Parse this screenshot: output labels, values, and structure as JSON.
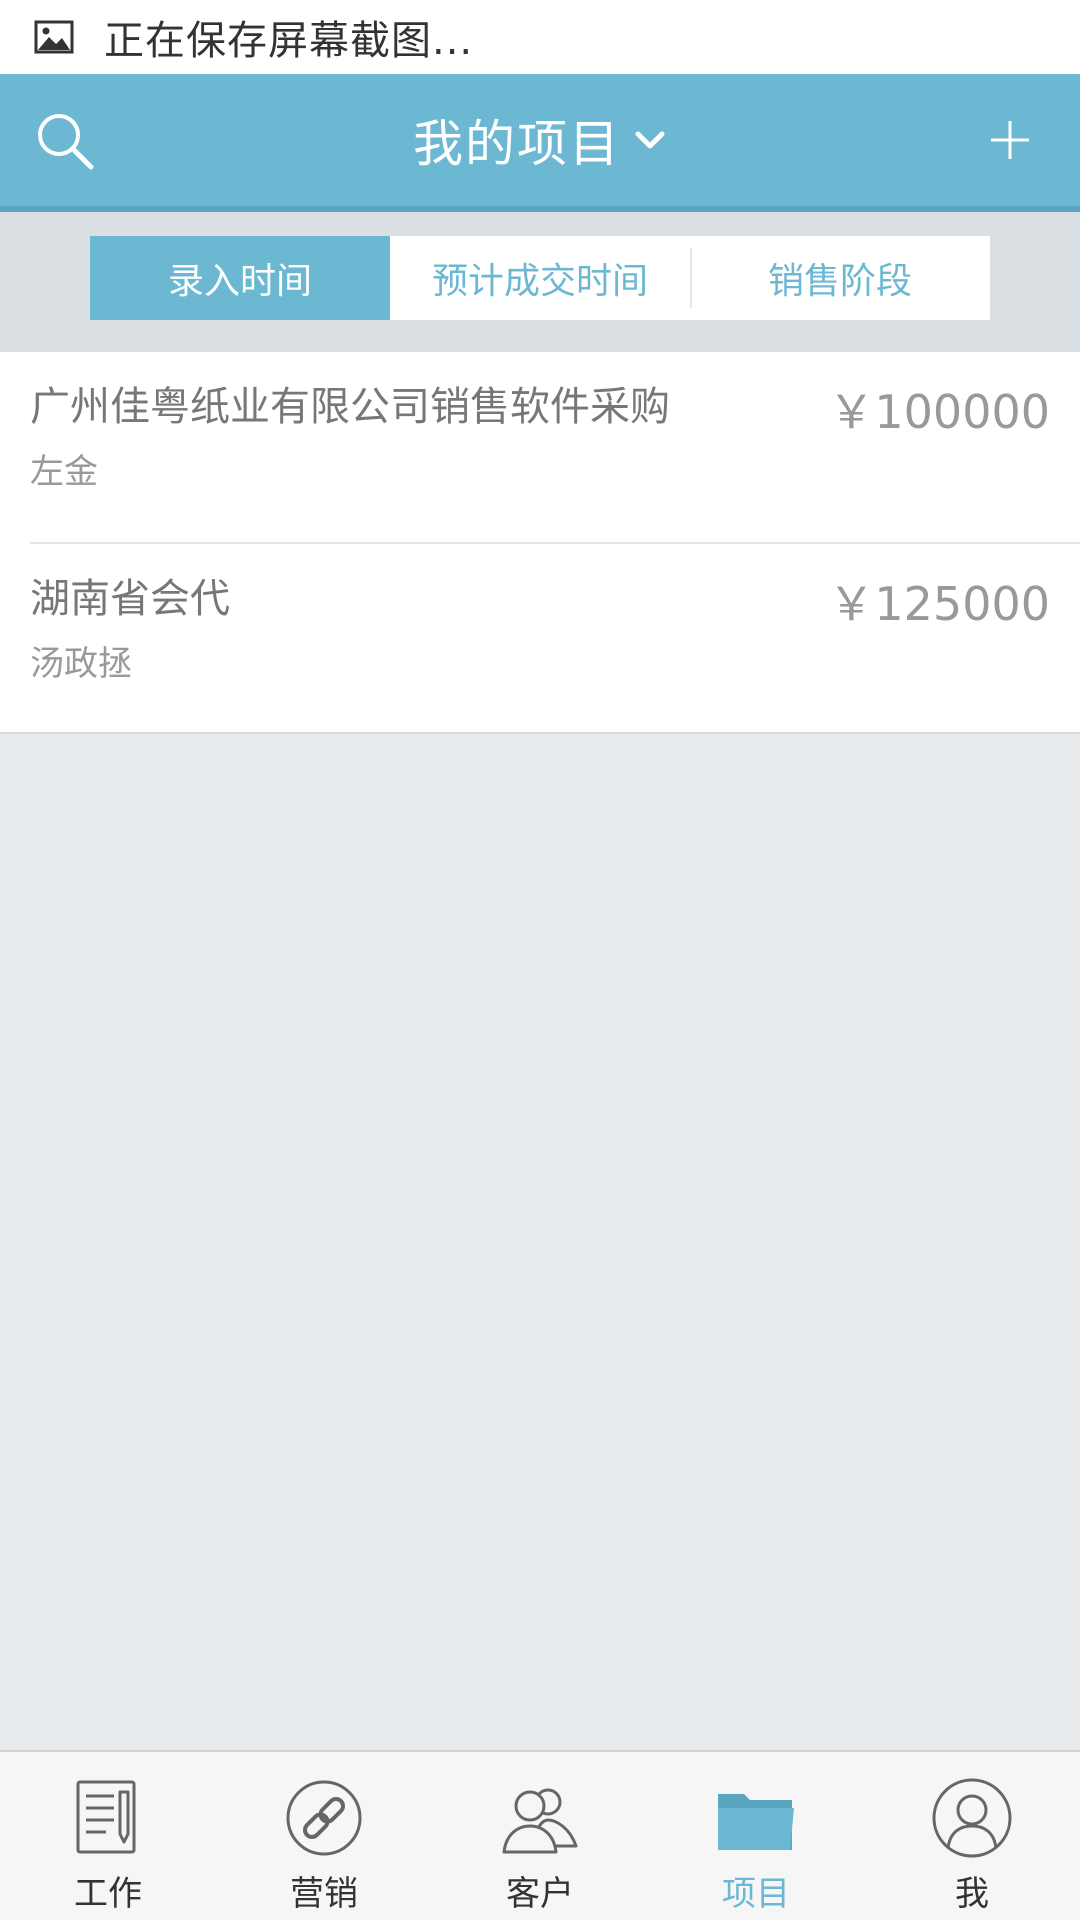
{
  "status_bar": {
    "icon": "image-icon",
    "text": "正在保存屏幕截图..."
  },
  "header": {
    "title": "我的项目",
    "search_icon": "search-icon",
    "dropdown_icon": "chevron-down-icon",
    "add_icon": "plus-icon",
    "background_color": "#6cb8d2"
  },
  "sort_tabs": [
    {
      "label": "录入时间",
      "active": true
    },
    {
      "label": "预计成交时间",
      "active": false
    },
    {
      "label": "销售阶段",
      "active": false
    }
  ],
  "projects": [
    {
      "name": "广州佳粤纸业有限公司销售软件采购",
      "owner": "左金",
      "amount": "￥100000"
    },
    {
      "name": "湖南省会代",
      "owner": "汤政拯",
      "amount": "￥125000"
    }
  ],
  "tab_bar": {
    "items": [
      {
        "label": "工作",
        "icon": "document-icon",
        "active": false
      },
      {
        "label": "营销",
        "icon": "link-icon",
        "active": false
      },
      {
        "label": "客户",
        "icon": "users-icon",
        "active": false
      },
      {
        "label": "项目",
        "icon": "folder-icon",
        "active": true
      },
      {
        "label": "我",
        "icon": "user-icon",
        "active": false
      }
    ],
    "active_color": "#6cb8d2"
  }
}
